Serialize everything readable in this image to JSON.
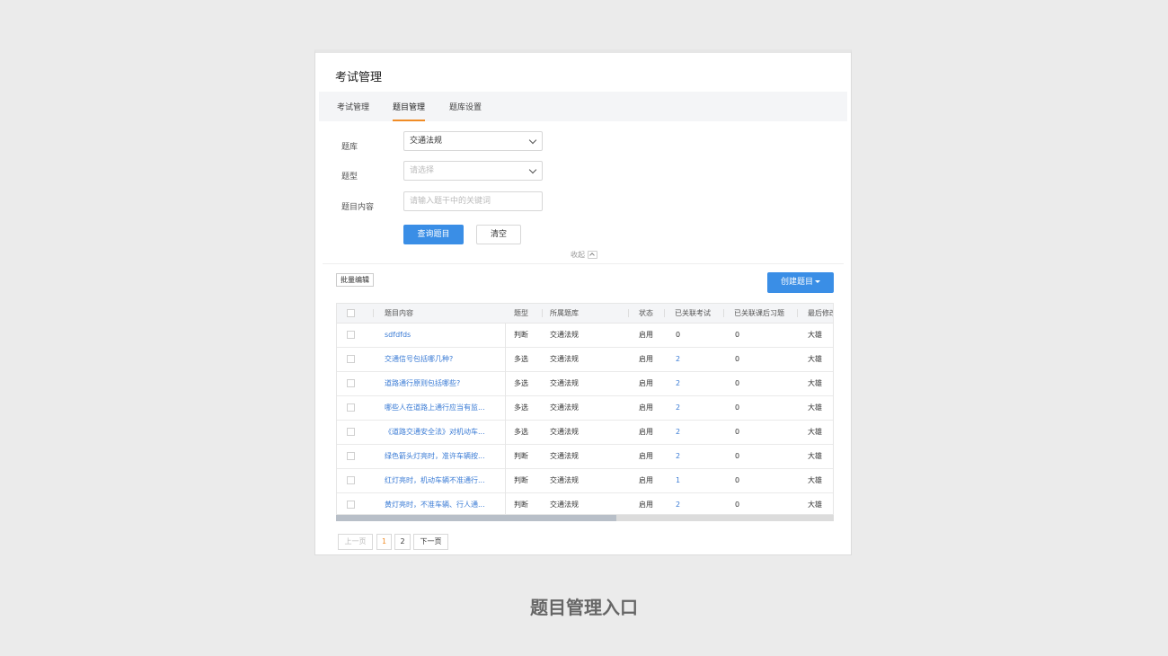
{
  "page_title": "考试管理",
  "tabs": [
    {
      "label": "考试管理",
      "active": false
    },
    {
      "label": "题目管理",
      "active": true
    },
    {
      "label": "题库设置",
      "active": false
    }
  ],
  "filters": {
    "bank_label": "题库",
    "bank_value": "交通法规",
    "type_label": "题型",
    "type_placeholder": "请选择",
    "content_label": "题目内容",
    "content_placeholder": "请输入题干中的关键词",
    "query_button": "查询题目",
    "clear_button": "清空",
    "collapse_label": "收起"
  },
  "toolbar": {
    "batch_edit": "批量编辑",
    "create_button": "创建题目"
  },
  "table": {
    "columns": [
      "题目内容",
      "题型",
      "所属题库",
      "状态",
      "已关联考试",
      "已关联课后习题",
      "最后修改"
    ],
    "rows": [
      {
        "content": "sdfdfds",
        "type": "判断",
        "bank": "交通法规",
        "status": "启用",
        "exams": "0",
        "exercises": "0",
        "modifier": "大雄"
      },
      {
        "content": "交通信号包括哪几种?",
        "type": "多选",
        "bank": "交通法规",
        "status": "启用",
        "exams": "2",
        "exercises": "0",
        "modifier": "大雄"
      },
      {
        "content": "道路通行原则包括哪些?",
        "type": "多选",
        "bank": "交通法规",
        "status": "启用",
        "exams": "2",
        "exercises": "0",
        "modifier": "大雄"
      },
      {
        "content": "哪些人在道路上通行应当有监...",
        "type": "多选",
        "bank": "交通法规",
        "status": "启用",
        "exams": "2",
        "exercises": "0",
        "modifier": "大雄"
      },
      {
        "content": "《道路交通安全法》对机动车...",
        "type": "多选",
        "bank": "交通法规",
        "status": "启用",
        "exams": "2",
        "exercises": "0",
        "modifier": "大雄"
      },
      {
        "content": "绿色箭头灯亮时，准许车辆按...",
        "type": "判断",
        "bank": "交通法规",
        "status": "启用",
        "exams": "2",
        "exercises": "0",
        "modifier": "大雄"
      },
      {
        "content": "红灯亮时，机动车辆不准通行...",
        "type": "判断",
        "bank": "交通法规",
        "status": "启用",
        "exams": "1",
        "exercises": "0",
        "modifier": "大雄"
      },
      {
        "content": "黄灯亮时，不准车辆、行人通...",
        "type": "判断",
        "bank": "交通法规",
        "status": "启用",
        "exams": "2",
        "exercises": "0",
        "modifier": "大雄"
      }
    ]
  },
  "pagination": {
    "prev": "上一页",
    "pages": [
      "1",
      "2"
    ],
    "current": "1",
    "next": "下一页"
  },
  "caption": "题目管理入口",
  "colors": {
    "primary": "#3a8ee6",
    "accent": "#f08c26",
    "link": "#3a7bd5"
  }
}
